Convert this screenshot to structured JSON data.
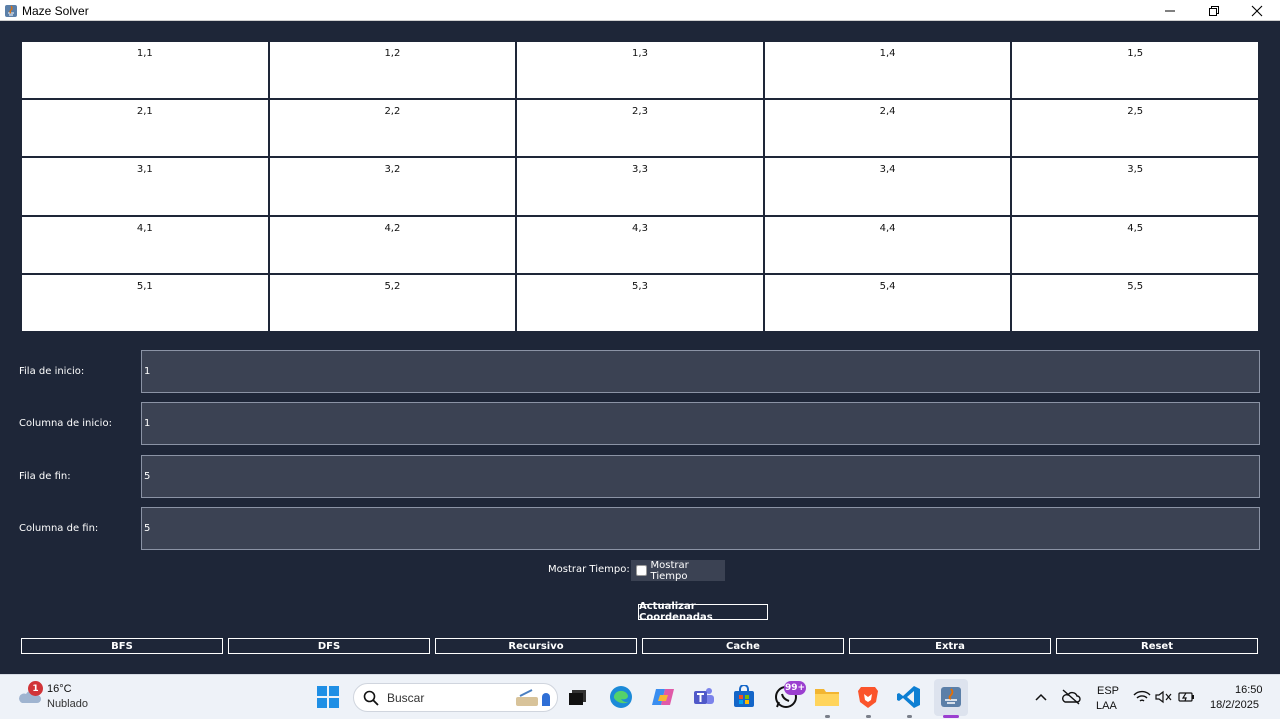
{
  "window": {
    "title": "Maze Solver"
  },
  "grid": {
    "rows": [
      [
        "1,1",
        "1,2",
        "1,3",
        "1,4",
        "1,5"
      ],
      [
        "2,1",
        "2,2",
        "2,3",
        "2,4",
        "2,5"
      ],
      [
        "3,1",
        "3,2",
        "3,3",
        "3,4",
        "3,5"
      ],
      [
        "4,1",
        "4,2",
        "4,3",
        "4,4",
        "4,5"
      ],
      [
        "5,1",
        "5,2",
        "5,3",
        "5,4",
        "5,5"
      ]
    ]
  },
  "form": {
    "start_row": {
      "label": "Fila de inicio:",
      "value": "1"
    },
    "start_col": {
      "label": "Columna de inicio:",
      "value": "1"
    },
    "end_row": {
      "label": "Fila de fin:",
      "value": "5"
    },
    "end_col": {
      "label": "Columna de fin:",
      "value": "5"
    }
  },
  "timer": {
    "label": "Mostrar Tiempo:",
    "checkbox_label": "Mostrar Tiempo",
    "checked": false
  },
  "buttons": {
    "update": "Actualizar Coordenadas",
    "algorithms": [
      "BFS",
      "DFS",
      "Recursivo",
      "Cache",
      "Extra",
      "Reset"
    ]
  },
  "taskbar": {
    "weather_temp": "16°C",
    "weather_condition": "Nublado",
    "weather_badge": "1",
    "search_placeholder": "Buscar",
    "whatsapp_badge": "99+",
    "lang_line1": "ESP",
    "lang_line2": "LAA",
    "time": "16:50",
    "date": "18/2/2025"
  },
  "colors": {
    "app_background": "#1e2638",
    "input_background": "#3b4253",
    "cell_background": "#ffffff",
    "accent_purple": "#9b3fd0"
  }
}
